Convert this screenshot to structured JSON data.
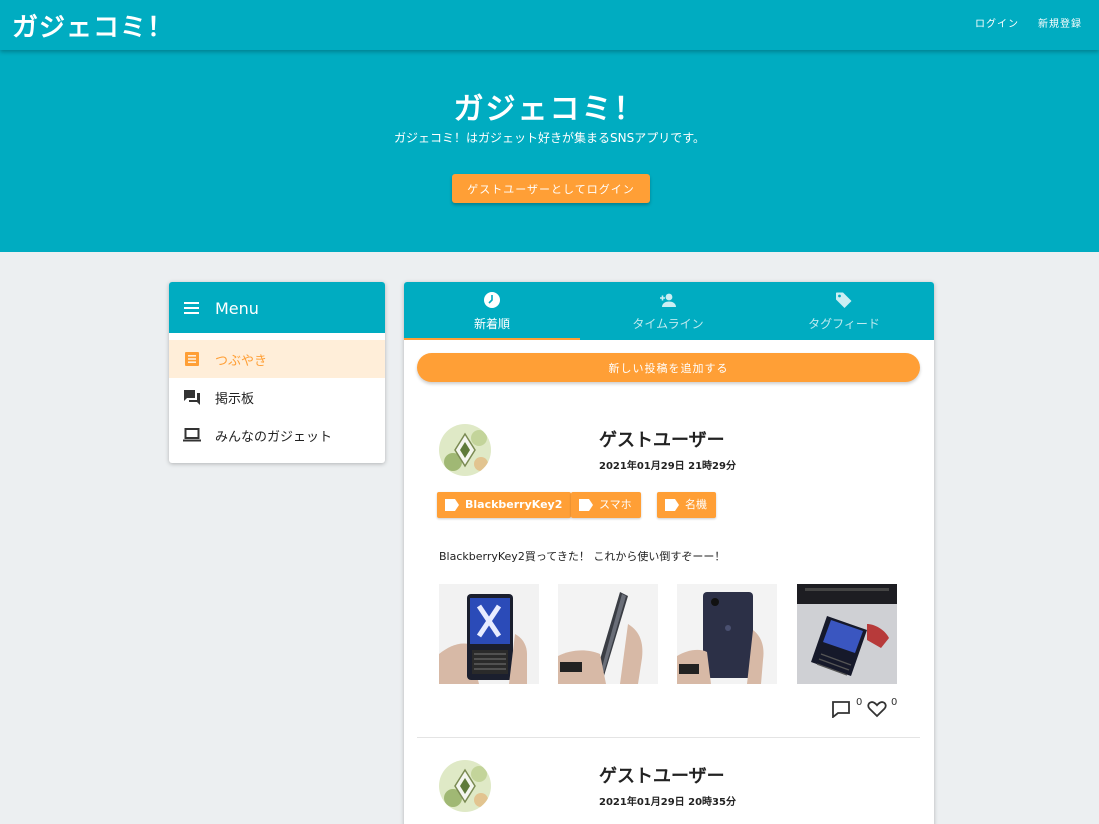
{
  "appbar": {
    "title": "ガジェコミ！",
    "login_label": "ログイン",
    "register_label": "新規登録"
  },
  "hero": {
    "title": "ガジェコミ！",
    "subtitle": "ガジェコミ！はガジェット好きが集まるSNSアプリです。",
    "guest_login_label": "ゲストユーザーとしてログイン"
  },
  "menu": {
    "title": "Menu",
    "items": [
      {
        "label": "つぶやき",
        "icon": "document-icon",
        "active": true
      },
      {
        "label": "掲示板",
        "icon": "forum-icon",
        "active": false
      },
      {
        "label": "みんなのガジェット",
        "icon": "laptop-icon",
        "active": false
      }
    ]
  },
  "tabs": [
    {
      "label": "新着順",
      "icon": "clock-icon",
      "active": true
    },
    {
      "label": "タイムライン",
      "icon": "add-user-icon",
      "active": false
    },
    {
      "label": "タグフィード",
      "icon": "tag-icon",
      "active": false
    }
  ],
  "add_post_label": "新しい投稿を追加する",
  "posts": [
    {
      "username": "ゲストユーザー",
      "timestamp": "2021年01月29日 21時29分",
      "tags": [
        "BlackberryKey2",
        "スマホ",
        "名機"
      ],
      "body": "BlackberryKey2買ってきた！ これから使い倒すぞーー！",
      "images": [
        "phone-front-photo",
        "phone-side-photo",
        "phone-back-photo",
        "phone-on-laptop-photo"
      ],
      "comment_count": "0",
      "like_count": "0"
    },
    {
      "username": "ゲストユーザー",
      "timestamp": "2021年01月29日 20時35分"
    }
  ],
  "colors": {
    "primary": "#00acc1",
    "accent": "#ff9f36",
    "active_menu_bg": "#ffeed9",
    "page_bg": "#eceff1"
  }
}
